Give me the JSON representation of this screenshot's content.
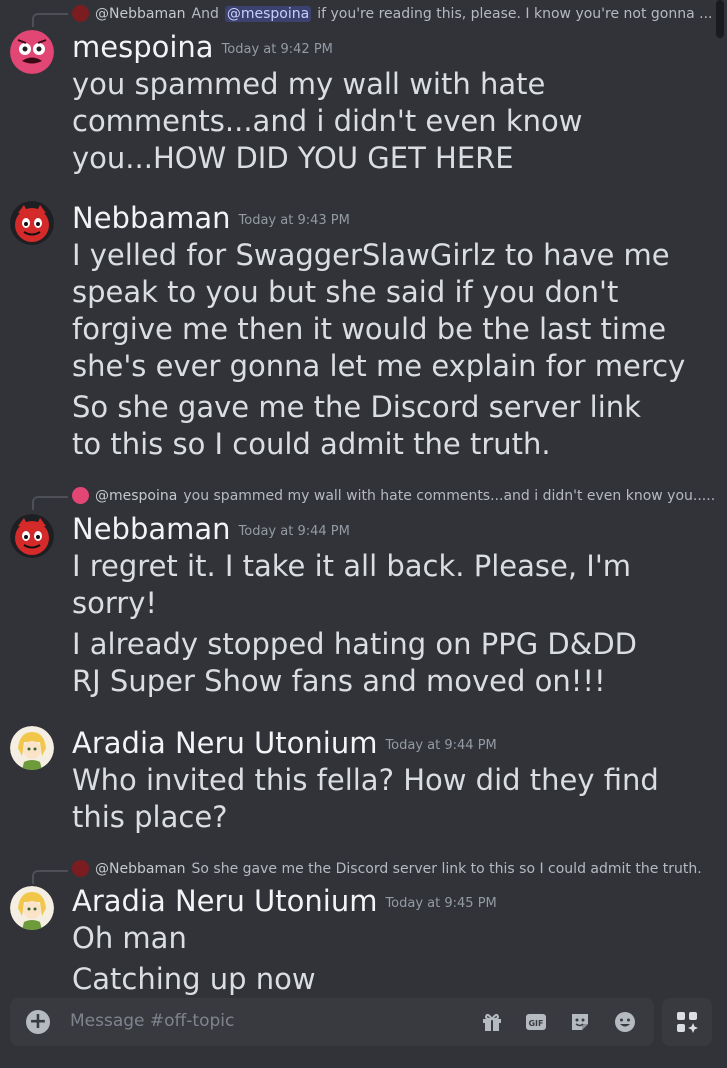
{
  "channel": {
    "placeholder": "Message #off-topic"
  },
  "messages": [
    {
      "reply": {
        "author": "@Nebbaman",
        "pre": "And",
        "mention": "@mespoina",
        "text": "if you're reading this, please. I know you're not gonna ..."
      },
      "author": "mespoina",
      "time": "Today at 9:42 PM",
      "lines": [
        "you spammed my wall with hate",
        "comments...and i didn't even know",
        "you...HOW DID YOU GET HERE"
      ]
    },
    {
      "author": "Nebbaman",
      "time": "Today at 9:43 PM",
      "lines": [
        "I yelled for SwaggerSlawGirlz to have me",
        "speak to you but she said if you don't",
        "forgive me then it would be the last time",
        "she's ever gonna let me explain for mercy"
      ],
      "lines2": [
        "So she gave me the Discord server link",
        "to this so I could admit the truth."
      ]
    },
    {
      "reply": {
        "author": "@mespoina",
        "text": "you spammed my wall with hate comments...and i didn't even know you....."
      },
      "author": "Nebbaman",
      "time": "Today at 9:44 PM",
      "lines": [
        "I regret it. I take it all back. Please, I'm",
        "sorry!"
      ],
      "lines2": [
        "I already stopped hating on PPG D&DD",
        "RJ Super Show fans and moved on!!!"
      ]
    },
    {
      "author": "Aradia Neru Utonium",
      "time": "Today at 9:44 PM",
      "lines": [
        "Who invited this fella? How did they find",
        "this place?"
      ]
    },
    {
      "reply": {
        "author": "@Nebbaman",
        "text": "So she gave me the Discord server link to this so I could admit the truth."
      },
      "author": "Aradia Neru Utonium",
      "time": "Today at 9:45 PM",
      "lines": [
        "Oh man"
      ],
      "lines2": [
        "Catching up now"
      ]
    }
  ],
  "icons": [
    "plus-circle-icon",
    "gift-icon",
    "gif-icon",
    "sticker-icon",
    "emoji-icon",
    "apps-icon"
  ],
  "colors": {
    "background": "#313338",
    "composer": "#383a40",
    "mention_bg": "#3c4270"
  }
}
